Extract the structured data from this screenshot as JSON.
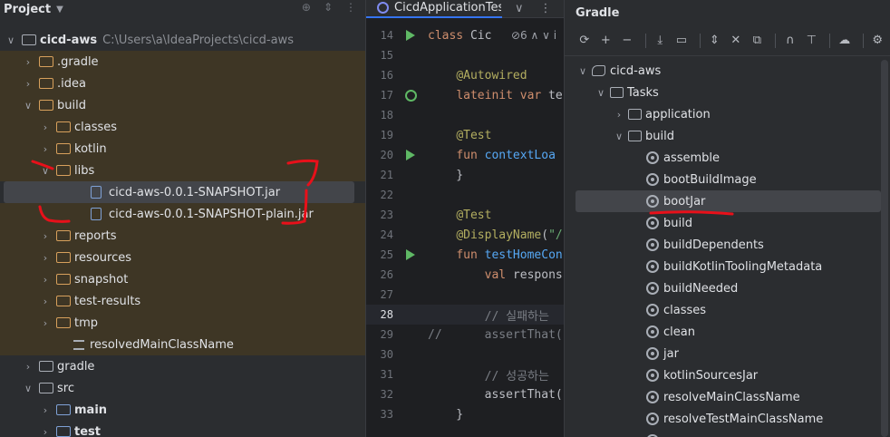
{
  "project_panel": {
    "title": "Project",
    "root_name": "cicd-aws",
    "root_path": "C:\\Users\\a\\IdeaProjects\\cicd-aws",
    "items": [
      {
        "label": ".gradle",
        "indent": 1,
        "arrow": "right",
        "icon": "folder",
        "hl": true
      },
      {
        "label": ".idea",
        "indent": 1,
        "arrow": "right",
        "icon": "folder",
        "hl": true
      },
      {
        "label": "build",
        "indent": 1,
        "arrow": "down",
        "icon": "folder",
        "hl": true
      },
      {
        "label": "classes",
        "indent": 2,
        "arrow": "right",
        "icon": "folder",
        "hl": true
      },
      {
        "label": "kotlin",
        "indent": 2,
        "arrow": "right",
        "icon": "folder",
        "hl": true
      },
      {
        "label": "libs",
        "indent": 2,
        "arrow": "down",
        "icon": "folder",
        "hl": true
      },
      {
        "label": "cicd-aws-0.0.1-SNAPSHOT.jar",
        "indent": 4,
        "arrow": "",
        "icon": "jar",
        "hl": true,
        "sel": true
      },
      {
        "label": "cicd-aws-0.0.1-SNAPSHOT-plain.jar",
        "indent": 4,
        "arrow": "",
        "icon": "jar",
        "hl": true
      },
      {
        "label": "reports",
        "indent": 2,
        "arrow": "right",
        "icon": "folder",
        "hl": true
      },
      {
        "label": "resources",
        "indent": 2,
        "arrow": "right",
        "icon": "folder",
        "hl": true
      },
      {
        "label": "snapshot",
        "indent": 2,
        "arrow": "right",
        "icon": "folder",
        "hl": true
      },
      {
        "label": "test-results",
        "indent": 2,
        "arrow": "right",
        "icon": "folder",
        "hl": true
      },
      {
        "label": "tmp",
        "indent": 2,
        "arrow": "right",
        "icon": "folder",
        "hl": true
      },
      {
        "label": "resolvedMainClassName",
        "indent": 3,
        "arrow": "",
        "icon": "file",
        "hl": true
      },
      {
        "label": "gradle",
        "indent": 1,
        "arrow": "right",
        "icon": "folder",
        "hl": false
      },
      {
        "label": "src",
        "indent": 1,
        "arrow": "down",
        "icon": "folder",
        "hl": false
      },
      {
        "label": "main",
        "indent": 2,
        "arrow": "right",
        "icon": "folder",
        "hl": false,
        "bold": true
      },
      {
        "label": "test",
        "indent": 2,
        "arrow": "right",
        "icon": "folder",
        "hl": false,
        "bold": true
      }
    ]
  },
  "editor": {
    "tab_label": "CicdApplicationTests.kt",
    "lines": [
      {
        "no": "14",
        "gutter": "run",
        "html": "<span class=\"k\">class</span> Cic"
      },
      {
        "no": "15",
        "gutter": "",
        "html": ""
      },
      {
        "no": "16",
        "gutter": "",
        "html": "    <span class=\"a\">@Autowired</span>"
      },
      {
        "no": "17",
        "gutter": "bean",
        "html": "    <span class=\"k\">lateinit var</span> te"
      },
      {
        "no": "18",
        "gutter": "",
        "html": ""
      },
      {
        "no": "19",
        "gutter": "",
        "html": "    <span class=\"a\">@Test</span>"
      },
      {
        "no": "20",
        "gutter": "run",
        "html": "    <span class=\"k\">fun</span> <span class=\"f\">contextLoa</span>"
      },
      {
        "no": "21",
        "gutter": "",
        "html": "    }"
      },
      {
        "no": "22",
        "gutter": "",
        "html": ""
      },
      {
        "no": "23",
        "gutter": "",
        "html": "    <span class=\"a\">@Test</span>"
      },
      {
        "no": "24",
        "gutter": "",
        "html": "    <span class=\"a\">@DisplayName</span>(<span class=\"s\">\"/</span>"
      },
      {
        "no": "25",
        "gutter": "run",
        "html": "    <span class=\"k\">fun</span> <span class=\"f\">testHomeCon</span>"
      },
      {
        "no": "26",
        "gutter": "",
        "html": "        <span class=\"k\">val</span> respons"
      },
      {
        "no": "27",
        "gutter": "",
        "html": ""
      },
      {
        "no": "28",
        "gutter": "",
        "html": "        <span class=\"c\">// 실패하는</span>",
        "cur": true
      },
      {
        "no": "29",
        "gutter": "",
        "html": "<span class=\"c\">//</span>      <span class=\"c\">assertThat(</span>"
      },
      {
        "no": "30",
        "gutter": "",
        "html": ""
      },
      {
        "no": "31",
        "gutter": "",
        "html": "        <span class=\"c\">// 성공하는</span>"
      },
      {
        "no": "32",
        "gutter": "",
        "html": "        assertThat("
      },
      {
        "no": "33",
        "gutter": "",
        "html": "    }"
      }
    ]
  },
  "gradle_panel": {
    "title": "Gradle",
    "toolbar_icons": [
      "reload-icon",
      "plus-icon",
      "minus-icon",
      "sep",
      "download-icon",
      "console-icon",
      "sep",
      "expand-icon",
      "collapse-icon",
      "dependencies-icon",
      "sep",
      "link-icon",
      "align-icon",
      "sep",
      "offline-icon",
      "sep",
      "settings-icon"
    ],
    "toolbar_glyphs": [
      "⟳",
      "+",
      "−",
      "",
      "⤓",
      "▭",
      "",
      "⇕",
      "✕",
      "⧉",
      "",
      "∩",
      "⊤",
      "",
      "☁",
      "",
      "⚙"
    ],
    "items": [
      {
        "label": "cicd-aws",
        "indent": 0,
        "arrow": "down",
        "icon": "elephant"
      },
      {
        "label": "Tasks",
        "indent": 1,
        "arrow": "down",
        "icon": "folder"
      },
      {
        "label": "application",
        "indent": 2,
        "arrow": "right",
        "icon": "folder"
      },
      {
        "label": "build",
        "indent": 2,
        "arrow": "down",
        "icon": "folder"
      },
      {
        "label": "assemble",
        "indent": 3,
        "arrow": "",
        "icon": "gear"
      },
      {
        "label": "bootBuildImage",
        "indent": 3,
        "arrow": "",
        "icon": "gear"
      },
      {
        "label": "bootJar",
        "indent": 3,
        "arrow": "",
        "icon": "gear",
        "sel": true
      },
      {
        "label": "build",
        "indent": 3,
        "arrow": "",
        "icon": "gear"
      },
      {
        "label": "buildDependents",
        "indent": 3,
        "arrow": "",
        "icon": "gear"
      },
      {
        "label": "buildKotlinToolingMetadata",
        "indent": 3,
        "arrow": "",
        "icon": "gear"
      },
      {
        "label": "buildNeeded",
        "indent": 3,
        "arrow": "",
        "icon": "gear"
      },
      {
        "label": "classes",
        "indent": 3,
        "arrow": "",
        "icon": "gear"
      },
      {
        "label": "clean",
        "indent": 3,
        "arrow": "",
        "icon": "gear"
      },
      {
        "label": "jar",
        "indent": 3,
        "arrow": "",
        "icon": "gear"
      },
      {
        "label": "kotlinSourcesJar",
        "indent": 3,
        "arrow": "",
        "icon": "gear"
      },
      {
        "label": "resolveMainClassName",
        "indent": 3,
        "arrow": "",
        "icon": "gear"
      },
      {
        "label": "resolveTestMainClassName",
        "indent": 3,
        "arrow": "",
        "icon": "gear"
      },
      {
        "label": "",
        "indent": 3,
        "arrow": "",
        "icon": "gear"
      }
    ]
  },
  "colors": {
    "annotation": "#e8101a",
    "highlight_bg": "#3e3625",
    "selection_bg": "#43454a"
  }
}
